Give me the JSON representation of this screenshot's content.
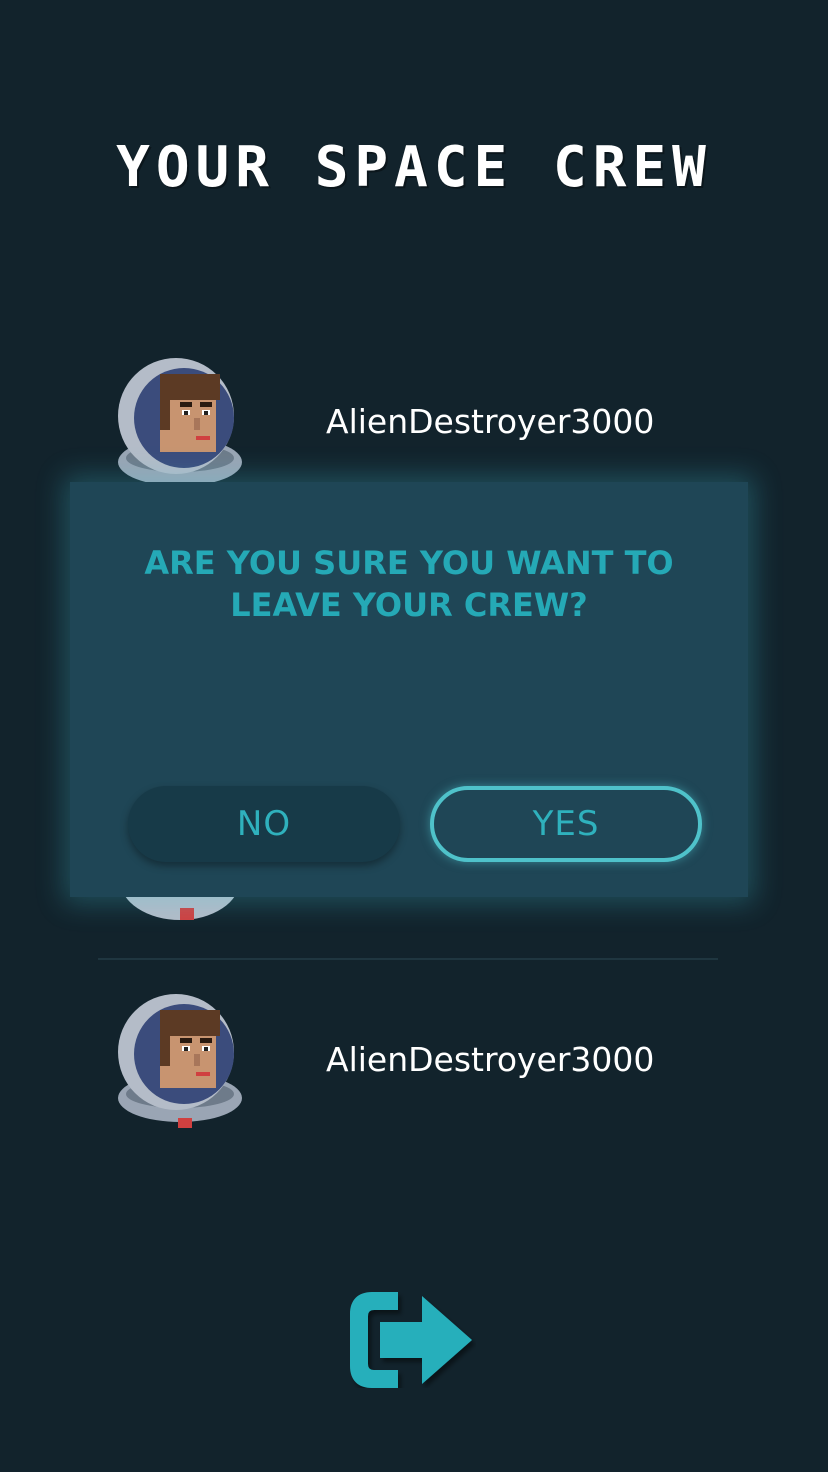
{
  "header": {
    "title": "YOUR SPACE CREW"
  },
  "crew": {
    "members": [
      {
        "name": "AlienDestroyer3000"
      },
      {
        "name": "AlienDestroyer3000"
      }
    ]
  },
  "dialog": {
    "message": "ARE YOU SURE YOU WANT TO LEAVE YOUR CREW?",
    "no_label": "NO",
    "yes_label": "YES"
  },
  "footer": {
    "leave_icon": "exit-icon"
  },
  "colors": {
    "background": "#12232c",
    "dialog_background": "#1f4656",
    "accent": "#25a9b6"
  }
}
